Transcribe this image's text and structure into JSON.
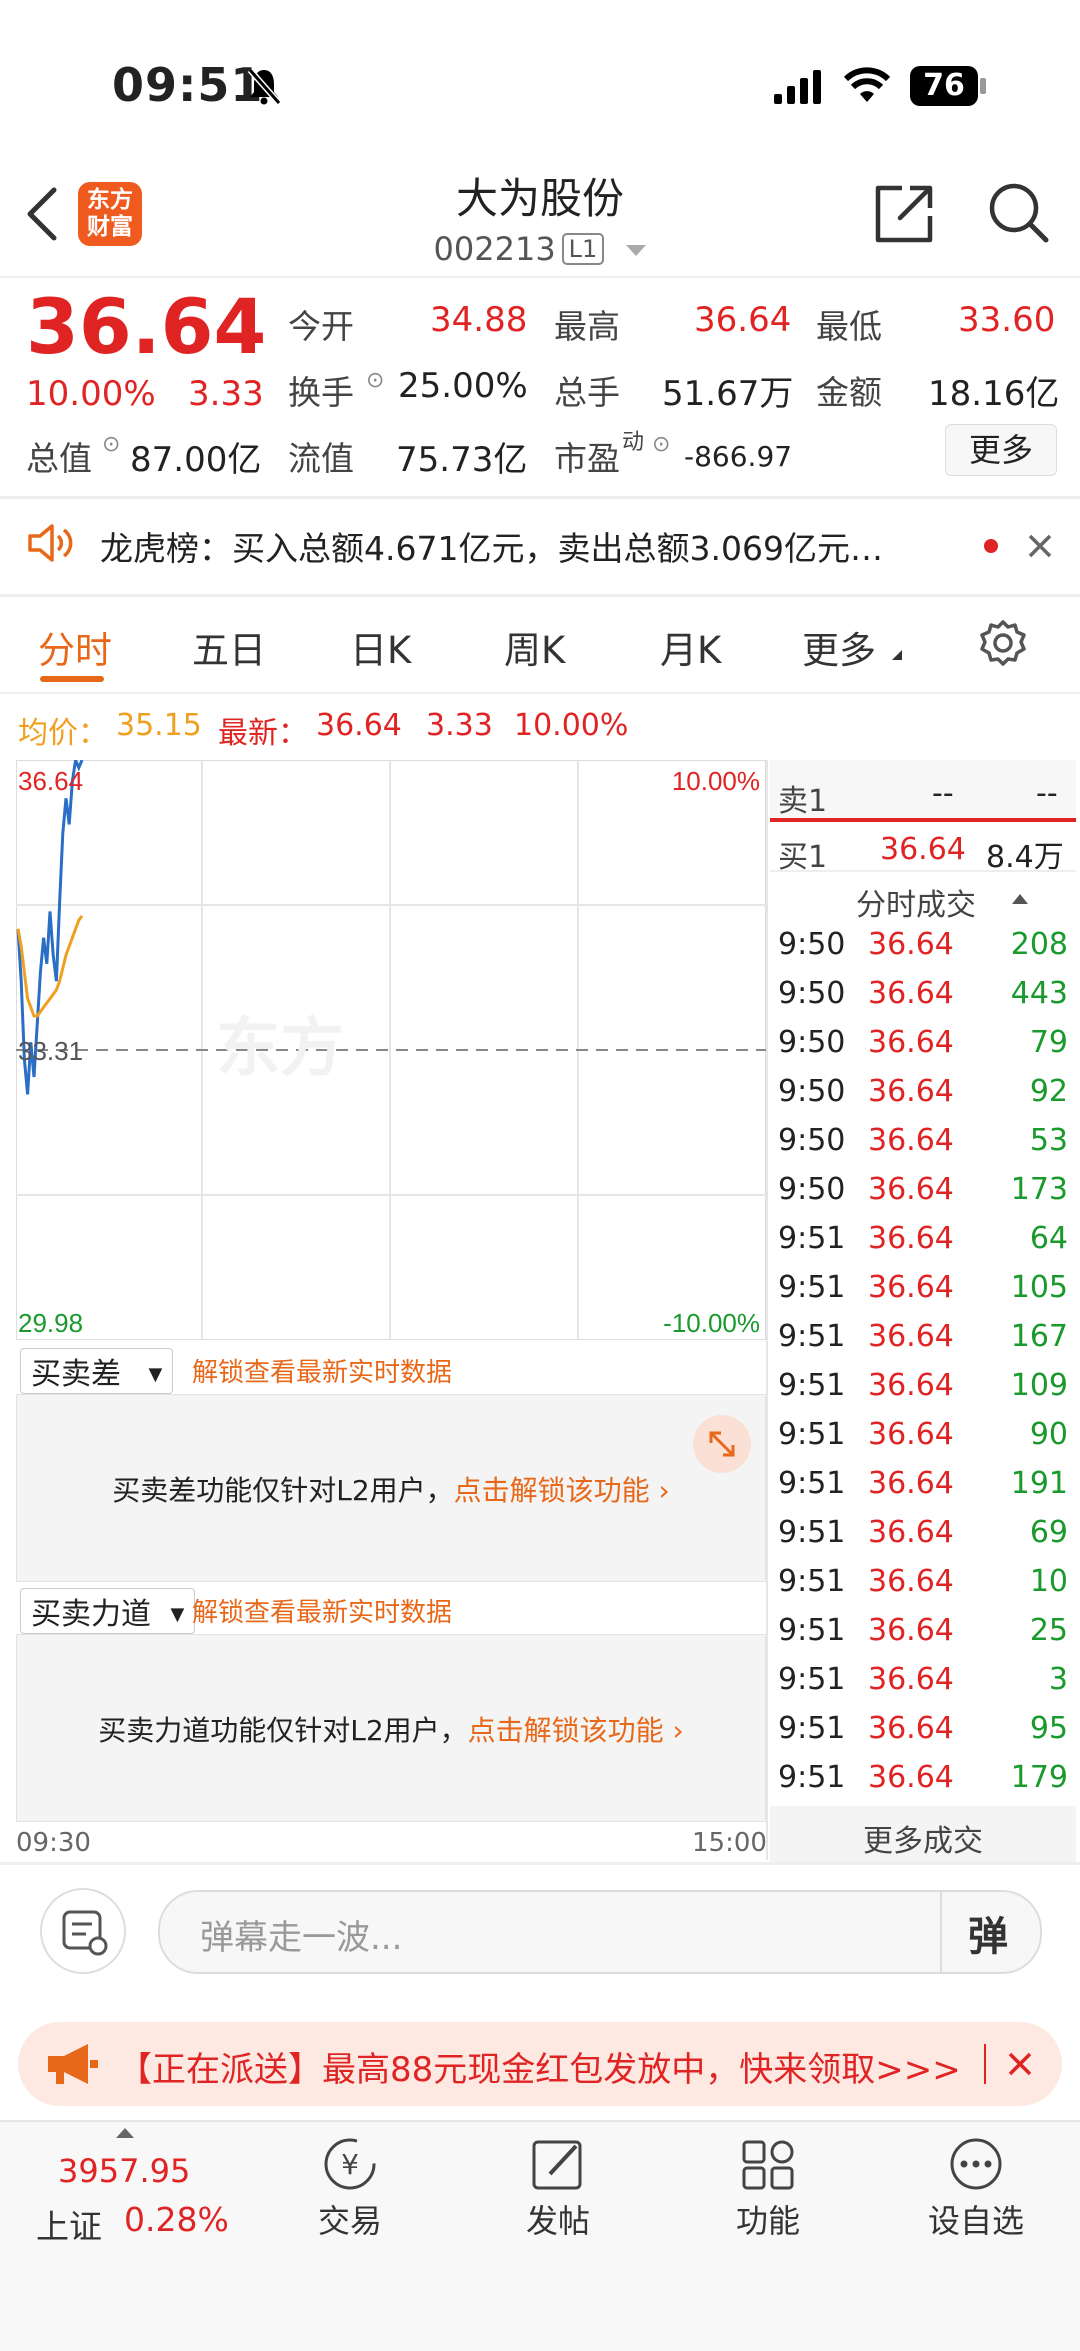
{
  "status_bar": {
    "time": "09:51",
    "battery": "76"
  },
  "header": {
    "title": "大为股份",
    "code": "002213",
    "level": "L1",
    "logo_text_1": "东方",
    "logo_text_2": "财富"
  },
  "quote": {
    "price": "36.64",
    "change_pct": "10.00%",
    "change": "3.33",
    "fields": {
      "open_label": "今开",
      "open": "34.88",
      "high_label": "最高",
      "high": "36.64",
      "low_label": "最低",
      "low": "33.60",
      "turnover_label": "换手",
      "turnover": "25.00%",
      "volume_label": "总手",
      "volume": "51.67万",
      "amount_label": "金额",
      "amount": "18.16亿",
      "mktcap_label": "总值",
      "mktcap": "87.00亿",
      "float_label": "流值",
      "float": "75.73亿",
      "pe_label": "市盈",
      "pe_sup": "动",
      "pe": "-866.97"
    },
    "more_button": "更多"
  },
  "notice": {
    "text": "龙虎榜：买入总额4.671亿元，卖出总额3.069亿元…"
  },
  "tabs": [
    "分时",
    "五日",
    "日K",
    "周K",
    "月K",
    "更多"
  ],
  "summary": {
    "avg_label": "均价：",
    "avg": "35.15",
    "latest_label": "最新：",
    "latest": "36.64",
    "change": "3.33",
    "change_pct": "10.00%"
  },
  "chart_data": {
    "type": "line",
    "ylim": [
      29.98,
      36.64
    ],
    "y_top_label": "36.64",
    "y_mid_label": "33.31",
    "y_bottom_label": "29.98",
    "pct_top_label": "10.00%",
    "pct_bottom_label": "-10.00%",
    "x_start_label": "09:30",
    "x_end_label": "15:00",
    "series": [
      {
        "color": "#2a6ec6",
        "values": [
          34.7,
          34.1,
          33.2,
          32.8,
          33.4,
          33.0,
          33.6,
          34.2,
          34.6,
          34.3,
          34.9,
          34.4,
          34.1,
          35.0,
          35.8,
          36.2,
          35.9,
          36.4,
          36.64,
          36.55,
          36.64
        ]
      },
      {
        "color": "#f0a020",
        "values": [
          34.7,
          34.5,
          34.2,
          33.9,
          33.8,
          33.7,
          33.7,
          33.75,
          33.8,
          33.85,
          33.9,
          33.95,
          34.0,
          34.1,
          34.25,
          34.4,
          34.5,
          34.6,
          34.7,
          34.8,
          34.85
        ]
      }
    ]
  },
  "orderbook": {
    "sell_label": "卖1",
    "sell_price": "--",
    "sell_vol": "--",
    "buy_label": "买1",
    "buy_price": "36.64",
    "buy_vol": "8.4万",
    "trades_header": "分时成交",
    "trades": [
      {
        "time": "9:50",
        "price": "36.64",
        "vol": "208"
      },
      {
        "time": "9:50",
        "price": "36.64",
        "vol": "443"
      },
      {
        "time": "9:50",
        "price": "36.64",
        "vol": "79"
      },
      {
        "time": "9:50",
        "price": "36.64",
        "vol": "92"
      },
      {
        "time": "9:50",
        "price": "36.64",
        "vol": "53"
      },
      {
        "time": "9:50",
        "price": "36.64",
        "vol": "173"
      },
      {
        "time": "9:51",
        "price": "36.64",
        "vol": "64"
      },
      {
        "time": "9:51",
        "price": "36.64",
        "vol": "105"
      },
      {
        "time": "9:51",
        "price": "36.64",
        "vol": "167"
      },
      {
        "time": "9:51",
        "price": "36.64",
        "vol": "109"
      },
      {
        "time": "9:51",
        "price": "36.64",
        "vol": "90"
      },
      {
        "time": "9:51",
        "price": "36.64",
        "vol": "191"
      },
      {
        "time": "9:51",
        "price": "36.64",
        "vol": "69"
      },
      {
        "time": "9:51",
        "price": "36.64",
        "vol": "10"
      },
      {
        "time": "9:51",
        "price": "36.64",
        "vol": "25"
      },
      {
        "time": "9:51",
        "price": "36.64",
        "vol": "3"
      },
      {
        "time": "9:51",
        "price": "36.64",
        "vol": "95"
      },
      {
        "time": "9:51",
        "price": "36.64",
        "vol": "179"
      }
    ],
    "more_trades": "更多成交"
  },
  "panels": {
    "spread_select": "买卖差",
    "spread_unlock": "解锁查看最新实时数据",
    "spread_msg": "买卖差功能仅针对L2用户，",
    "spread_link": "点击解锁该功能",
    "force_select": "买卖力道",
    "force_unlock": "解锁查看最新实时数据",
    "force_msg": "买卖力道功能仅针对L2用户，",
    "force_link": "点击解锁该功能"
  },
  "danmu": {
    "placeholder": "弹幕走一波...",
    "send_label": "弹"
  },
  "promo": {
    "text": "【正在派送】最高88元现金红包发放中，快来领取>>>"
  },
  "bottom_nav": {
    "index_value": "3957.95",
    "index_name": "上证",
    "index_pct": "0.28%",
    "items": [
      "交易",
      "发帖",
      "功能",
      "设自选"
    ]
  }
}
